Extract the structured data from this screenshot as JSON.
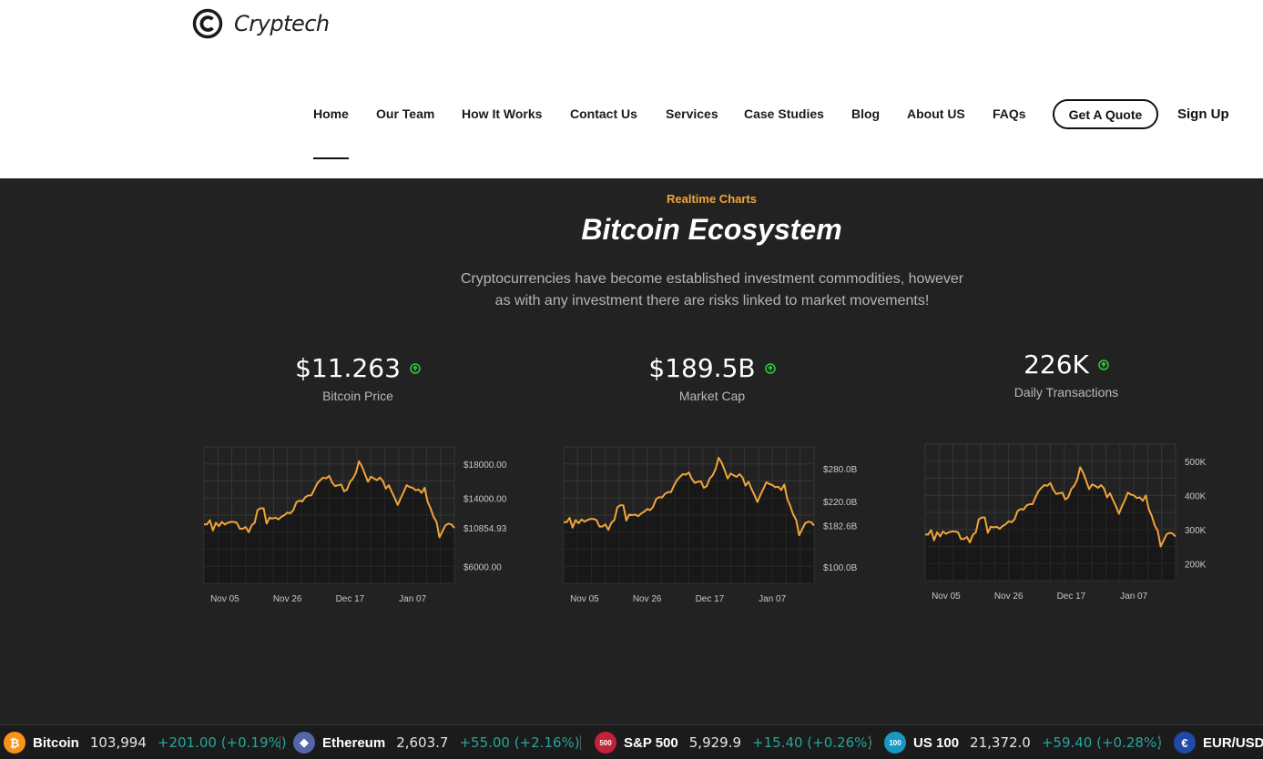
{
  "brand": {
    "name": "Cryptech",
    "icon": "copyright-c-icon"
  },
  "nav": {
    "items": [
      "Home",
      "Our Team",
      "How It Works",
      "Contact Us",
      "Services",
      "Case Studies",
      "Blog",
      "About US",
      "FAQs"
    ],
    "active": "Home",
    "quote_label": "Get A Quote",
    "signup_label": "Sign Up"
  },
  "hero": {
    "eyebrow": "Realtime Charts",
    "title": "Bitcoin Ecosystem",
    "desc_line1": "Cryptocurrencies have become established investment commodities, however",
    "desc_line2": "as with any investment there are risks linked to market movements!"
  },
  "stats": [
    {
      "value": "$11.263",
      "label": "Bitcoin Price",
      "trend": "up"
    },
    {
      "value": "$189.5B",
      "label": "Market Cap",
      "trend": "up"
    },
    {
      "value": "226K",
      "label": "Daily Transactions",
      "trend": "up"
    }
  ],
  "colors": {
    "accent": "#f0a43a",
    "up": "#2ecc40",
    "dark_bg": "#222222",
    "ticker_up": "#26a69a"
  },
  "chart_data": [
    {
      "type": "line",
      "title": "",
      "xlabel": "",
      "ylabel": "",
      "x_ticks": [
        "Nov 05",
        "Nov 26",
        "Dec 17",
        "Jan 07"
      ],
      "y_ticks": [
        6000,
        14000,
        18000
      ],
      "y_tick_labels": [
        "$6000.00",
        "$14000.00",
        "$18000.00"
      ],
      "last_value_label": "$10854.93",
      "ylim": [
        4000,
        20000
      ],
      "grid": true,
      "x": [
        "Oct 29",
        "Oct 30",
        "Oct 31",
        "Nov 01",
        "Nov 02",
        "Nov 03",
        "Nov 04",
        "Nov 05",
        "Nov 06",
        "Nov 07",
        "Nov 08",
        "Nov 09",
        "Nov 10",
        "Nov 11",
        "Nov 12",
        "Nov 13",
        "Nov 14",
        "Nov 15",
        "Nov 16",
        "Nov 17",
        "Nov 18",
        "Nov 19",
        "Nov 20",
        "Nov 21",
        "Nov 22",
        "Nov 23",
        "Nov 24",
        "Nov 25",
        "Nov 26",
        "Nov 27",
        "Nov 28",
        "Nov 29",
        "Nov 30",
        "Dec 01",
        "Dec 02",
        "Dec 03",
        "Dec 04",
        "Dec 05",
        "Dec 06",
        "Dec 07",
        "Dec 08",
        "Dec 09",
        "Dec 10",
        "Dec 11",
        "Dec 12",
        "Dec 13",
        "Dec 14",
        "Dec 15",
        "Dec 16",
        "Dec 17",
        "Dec 18",
        "Dec 19",
        "Dec 20",
        "Dec 21",
        "Dec 22",
        "Dec 23",
        "Dec 24",
        "Dec 25",
        "Dec 26",
        "Dec 27",
        "Dec 28",
        "Dec 29",
        "Dec 30",
        "Dec 31",
        "Jan 01",
        "Jan 02",
        "Jan 03",
        "Jan 04",
        "Jan 05",
        "Jan 06",
        "Jan 07",
        "Jan 08",
        "Jan 09",
        "Jan 10",
        "Jan 11",
        "Jan 12",
        "Jan 13",
        "Jan 14",
        "Jan 15",
        "Jan 16",
        "Jan 17",
        "Jan 18",
        "Jan 19",
        "Jan 20",
        "Jan 21"
      ],
      "values": [
        10900,
        10900,
        11400,
        10200,
        11100,
        10700,
        11200,
        10900,
        11100,
        11200,
        11200,
        11100,
        10400,
        10400,
        10600,
        10000,
        10800,
        11100,
        12600,
        12800,
        12800,
        11000,
        11700,
        11600,
        11700,
        11500,
        11800,
        12000,
        12300,
        12200,
        12600,
        13500,
        13700,
        13600,
        14100,
        14300,
        14300,
        15000,
        15700,
        16100,
        16400,
        16300,
        16600,
        15800,
        15400,
        15500,
        15600,
        14800,
        15000,
        15900,
        16300,
        17000,
        18300,
        17700,
        16800,
        15900,
        16500,
        16300,
        16100,
        16400,
        16000,
        15100,
        15500,
        14700,
        14000,
        13200,
        14000,
        14700,
        15500,
        15300,
        15200,
        14900,
        15000,
        14600,
        15200,
        13600,
        12800,
        11800,
        11200,
        9400,
        10100,
        10800,
        11000,
        10900,
        10500
      ]
    },
    {
      "type": "line",
      "title": "",
      "xlabel": "",
      "ylabel": "",
      "x_ticks": [
        "Nov 05",
        "Nov 26",
        "Dec 17",
        "Jan 07"
      ],
      "y_ticks": [
        100,
        220,
        280
      ],
      "y_tick_labels": [
        "$100.0B",
        "$220.0B",
        "$280.0B"
      ],
      "last_value_label": "$182.6B",
      "ylim": [
        70,
        320
      ],
      "grid": true,
      "x": [
        "Oct 29",
        "Oct 30",
        "Oct 31",
        "Nov 01",
        "Nov 02",
        "Nov 03",
        "Nov 04",
        "Nov 05",
        "Nov 06",
        "Nov 07",
        "Nov 08",
        "Nov 09",
        "Nov 10",
        "Nov 11",
        "Nov 12",
        "Nov 13",
        "Nov 14",
        "Nov 15",
        "Nov 16",
        "Nov 17",
        "Nov 18",
        "Nov 19",
        "Nov 20",
        "Nov 21",
        "Nov 22",
        "Nov 23",
        "Nov 24",
        "Nov 25",
        "Nov 26",
        "Nov 27",
        "Nov 28",
        "Nov 29",
        "Nov 30",
        "Dec 01",
        "Dec 02",
        "Dec 03",
        "Dec 04",
        "Dec 05",
        "Dec 06",
        "Dec 07",
        "Dec 08",
        "Dec 09",
        "Dec 10",
        "Dec 11",
        "Dec 12",
        "Dec 13",
        "Dec 14",
        "Dec 15",
        "Dec 16",
        "Dec 17",
        "Dec 18",
        "Dec 19",
        "Dec 20",
        "Dec 21",
        "Dec 22",
        "Dec 23",
        "Dec 24",
        "Dec 25",
        "Dec 26",
        "Dec 27",
        "Dec 28",
        "Dec 29",
        "Dec 30",
        "Dec 31",
        "Jan 01",
        "Jan 02",
        "Jan 03",
        "Jan 04",
        "Jan 05",
        "Jan 06",
        "Jan 07",
        "Jan 08",
        "Jan 09",
        "Jan 10",
        "Jan 11",
        "Jan 12",
        "Jan 13",
        "Jan 14",
        "Jan 15",
        "Jan 16",
        "Jan 17",
        "Jan 18",
        "Jan 19",
        "Jan 20",
        "Jan 21"
      ],
      "values": [
        182,
        182,
        190,
        172,
        186,
        180,
        187,
        183,
        186,
        188,
        188,
        186,
        174,
        174,
        178,
        168,
        181,
        186,
        209,
        213,
        213,
        185,
        196,
        195,
        196,
        193,
        198,
        201,
        206,
        204,
        210,
        224,
        228,
        227,
        234,
        237,
        237,
        249,
        259,
        265,
        270,
        269,
        273,
        261,
        254,
        256,
        257,
        245,
        248,
        262,
        268,
        280,
        300,
        291,
        277,
        262,
        271,
        268,
        265,
        270,
        264,
        249,
        256,
        243,
        232,
        219,
        232,
        243,
        255,
        252,
        250,
        246,
        247,
        241,
        251,
        225,
        212,
        196,
        186,
        158,
        169,
        180,
        183,
        182,
        176
      ]
    },
    {
      "type": "line",
      "title": "",
      "xlabel": "",
      "ylabel": "",
      "x_ticks": [
        "Nov 05",
        "Nov 26",
        "Dec 17",
        "Jan 07"
      ],
      "y_ticks": [
        200,
        300,
        400,
        500
      ],
      "y_tick_labels": [
        "200K",
        "300K",
        "400K",
        "500K"
      ],
      "ylim": [
        150,
        550
      ],
      "grid": true,
      "x": [
        "Oct 29",
        "Oct 30",
        "Oct 31",
        "Nov 01",
        "Nov 02",
        "Nov 03",
        "Nov 04",
        "Nov 05",
        "Nov 06",
        "Nov 07",
        "Nov 08",
        "Nov 09",
        "Nov 10",
        "Nov 11",
        "Nov 12",
        "Nov 13",
        "Nov 14",
        "Nov 15",
        "Nov 16",
        "Nov 17",
        "Nov 18",
        "Nov 19",
        "Nov 20",
        "Nov 21",
        "Nov 22",
        "Nov 23",
        "Nov 24",
        "Nov 25",
        "Nov 26",
        "Nov 27",
        "Nov 28",
        "Nov 29",
        "Nov 30",
        "Dec 01",
        "Dec 02",
        "Dec 03",
        "Dec 04",
        "Dec 05",
        "Dec 06",
        "Dec 07",
        "Dec 08",
        "Dec 09",
        "Dec 10",
        "Dec 11",
        "Dec 12",
        "Dec 13",
        "Dec 14",
        "Dec 15",
        "Dec 16",
        "Dec 17",
        "Dec 18",
        "Dec 19",
        "Dec 20",
        "Dec 21",
        "Dec 22",
        "Dec 23",
        "Dec 24",
        "Dec 25",
        "Dec 26",
        "Dec 27",
        "Dec 28",
        "Dec 29",
        "Dec 30",
        "Dec 31",
        "Jan 01",
        "Jan 02",
        "Jan 03",
        "Jan 04",
        "Jan 05",
        "Jan 06",
        "Jan 07",
        "Jan 08",
        "Jan 09",
        "Jan 10",
        "Jan 11",
        "Jan 12",
        "Jan 13",
        "Jan 14",
        "Jan 15",
        "Jan 16",
        "Jan 17",
        "Jan 18",
        "Jan 19",
        "Jan 20",
        "Jan 21"
      ],
      "values": [
        285,
        285,
        298,
        268,
        292,
        280,
        294,
        287,
        292,
        294,
        294,
        292,
        272,
        272,
        278,
        262,
        284,
        292,
        330,
        335,
        335,
        290,
        308,
        306,
        308,
        302,
        310,
        315,
        324,
        321,
        330,
        354,
        360,
        358,
        370,
        374,
        374,
        394,
        412,
        422,
        430,
        428,
        436,
        416,
        404,
        406,
        408,
        388,
        394,
        418,
        428,
        446,
        482,
        466,
        442,
        418,
        432,
        428,
        422,
        430,
        420,
        394,
        406,
        386,
        368,
        346,
        368,
        386,
        408,
        402,
        400,
        392,
        394,
        384,
        400,
        360,
        340,
        312,
        296,
        250,
        268,
        286,
        290,
        288,
        279
      ]
    }
  ],
  "ticker": [
    {
      "name": "Bitcoin",
      "price": "103,994",
      "change": "+201.00 (+0.19%)",
      "icon": "bitcoin-icon",
      "color": "#f7931a",
      "glyph": "₿"
    },
    {
      "name": "Ethereum",
      "price": "2,603.7",
      "change": "+55.00 (+2.16%)",
      "icon": "ethereum-icon",
      "color": "#5465a8",
      "glyph": "◆"
    },
    {
      "name": "S&P 500",
      "price": "5,929.9",
      "change": "+15.40 (+0.26%)",
      "icon": "sp500-icon",
      "color": "#c4213a",
      "glyph": "500"
    },
    {
      "name": "US 100",
      "price": "21,372.0",
      "change": "+59.40 (+0.28%)",
      "icon": "us100-icon",
      "color": "#1799c4",
      "glyph": "100"
    },
    {
      "name": "EUR/USD",
      "price": "",
      "change": "",
      "icon": "eur-usd-flag-icon",
      "color": "#1f4aa8",
      "glyph": "€"
    }
  ]
}
